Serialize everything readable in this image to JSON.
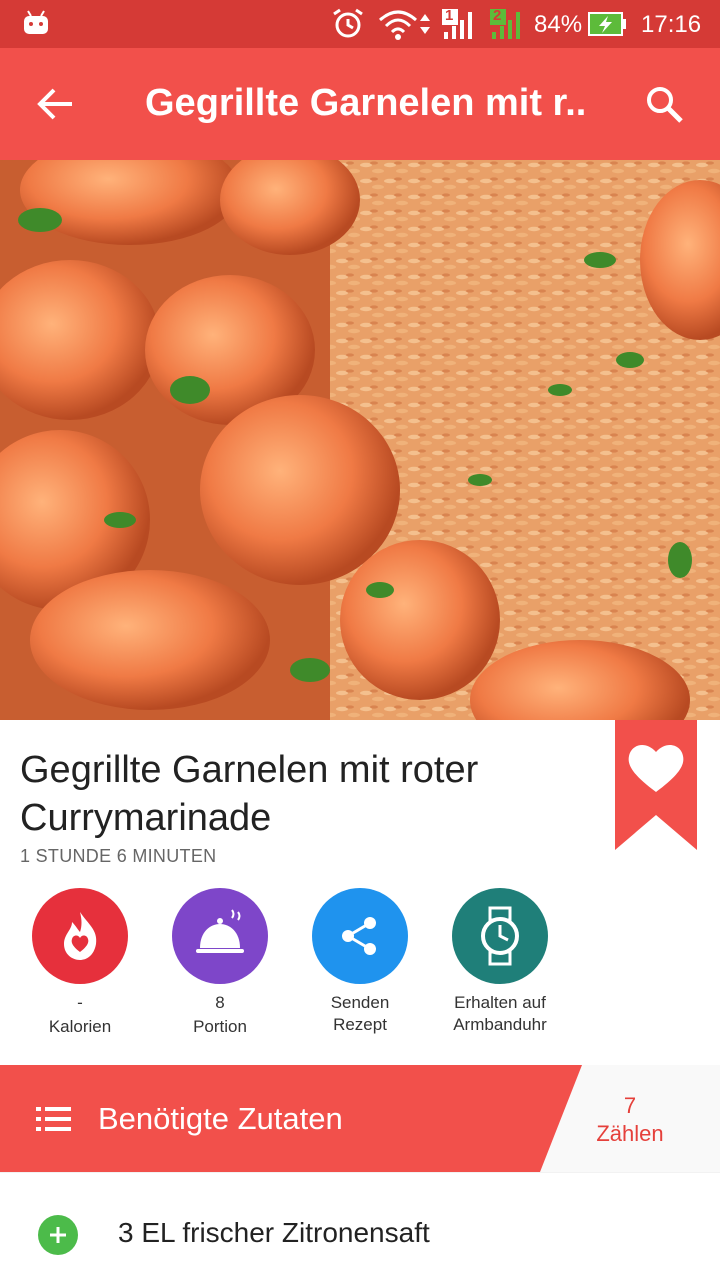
{
  "status_bar": {
    "battery": "84%",
    "time": "17:16",
    "sim1": "1",
    "sim2": "2",
    "color": "#d53a36"
  },
  "app_bar": {
    "title": "Gegrillte Garnelen mit r...",
    "color": "#f2504b"
  },
  "recipe": {
    "title_line1": "Gegrillte Garnelen mit roter",
    "title_line2": "Currymarinade",
    "duration": "1 STUNDE 6 MINUTEN"
  },
  "actions": [
    {
      "icon": "flame-heart-icon",
      "line1": "-",
      "line2": "Kalorien",
      "color": "#e6303c"
    },
    {
      "icon": "cloche-icon",
      "line1": "8",
      "line2": "Portion",
      "color": "#7e46c9"
    },
    {
      "icon": "share-icon",
      "line1": "Senden",
      "line2": "Rezept",
      "color": "#1f93ee"
    },
    {
      "icon": "watch-icon",
      "line1": "Erhalten auf",
      "line2": "Armbanduhr",
      "color": "#1f7f79"
    }
  ],
  "ingredients_header": {
    "label": "Benötigte Zutaten",
    "count": "7",
    "count_label": "Zählen"
  },
  "ingredients": [
    {
      "text": "3 EL frischer Zitronensaft"
    }
  ]
}
